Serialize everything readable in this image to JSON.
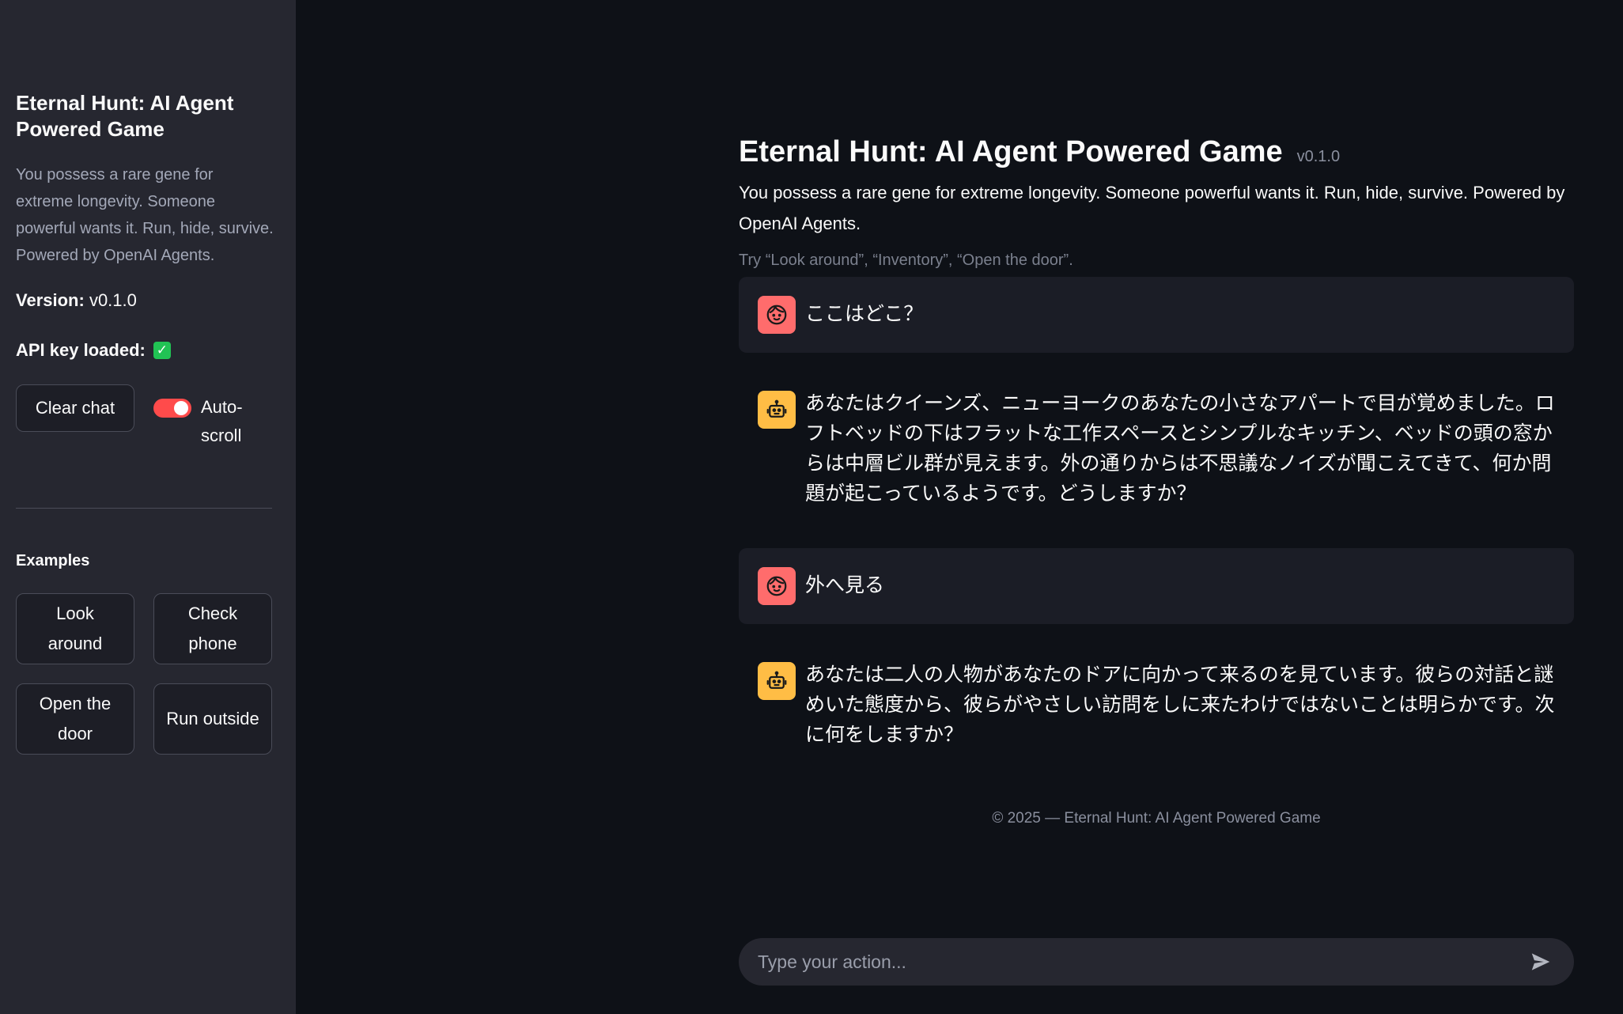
{
  "sidebar": {
    "title": "Eternal Hunt: AI Agent Powered Game",
    "description": "You possess a rare gene for extreme longevity. Someone powerful wants it. Run, hide, survive. Powered by OpenAI Agents.",
    "version_label": "Version:",
    "version_value": "v0.1.0",
    "api_label": "API key loaded:",
    "api_status_icon": "check-mark-icon",
    "clear_chat_label": "Clear chat",
    "autoscroll_label": "Auto-scroll",
    "autoscroll_on": true,
    "examples_heading": "Examples",
    "examples": [
      {
        "label": "Look around"
      },
      {
        "label": "Check phone"
      },
      {
        "label": "Open the door"
      },
      {
        "label": "Run outside"
      }
    ]
  },
  "main": {
    "title": "Eternal Hunt: AI Agent Powered Game",
    "version": "v0.1.0",
    "description": "You possess a rare gene for extreme longevity. Someone powerful wants it. Run, hide, survive. Powered by OpenAI Agents.",
    "hint": "Try “Look around”, “Inventory”, “Open the door”.",
    "messages": [
      {
        "role": "user",
        "text": "ここはどこ？"
      },
      {
        "role": "assistant",
        "text": "あなたはクイーンズ、ニューヨークのあなたの小さなアパートで目が覚めました。ロフトベッドの下はフラットな工作スペースとシンプルなキッチン、ベッドの頭の窓からは中層ビル群が見えます。外の通りからは不思議なノイズが聞こえてきて、何か問題が起こっているようです。どうしますか？"
      },
      {
        "role": "user",
        "text": "外へ見る"
      },
      {
        "role": "assistant",
        "text": "あなたは二人の人物があなたのドアに向かって来るのを見ています。彼らの対話と謎めいた態度から、彼らがやさしい訪問をしに来たわけではないことは明らかです。次に何をしますか？"
      }
    ],
    "footer": "© 2025 — Eternal Hunt: AI Agent Powered Game",
    "input_placeholder": "Type your action...",
    "input_value": ""
  },
  "colors": {
    "sidebar_bg": "#262730",
    "main_bg": "#0e1117",
    "accent": "#ff4b4b",
    "user_avatar": "#ff6c6c",
    "assistant_avatar": "#ffbd45"
  }
}
